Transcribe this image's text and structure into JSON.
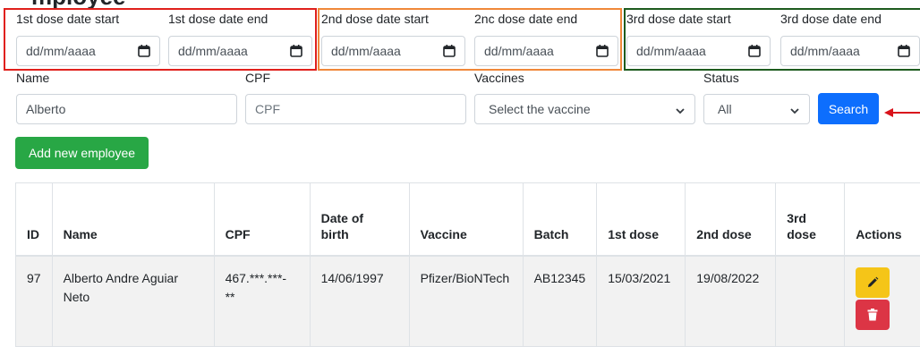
{
  "page": {
    "title_partial": "mployee"
  },
  "filters": {
    "dose1_start_label": "1st dose date start",
    "dose1_end_label": "1st dose date end",
    "dose2_start_label": "2nd dose date start",
    "dose2_end_label": "2nc dose date end",
    "dose3_start_label": "3rd dose date start",
    "dose3_end_label": "3rd dose date end",
    "date_placeholder": "dd/mm/aaaa",
    "name_label": "Name",
    "name_value": "Alberto",
    "cpf_label": "CPF",
    "cpf_placeholder": "CPF",
    "vaccines_label": "Vaccines",
    "vaccines_selected": "Select the vaccine",
    "status_label": "Status",
    "status_selected": "All",
    "search_button": "Search"
  },
  "annotations": {
    "dose1_box_color": "#e0201c",
    "dose2_box_color": "#f0883a",
    "dose3_box_color": "#1d5b1e",
    "arrow_color": "#d9121b"
  },
  "actions": {
    "add_employee_button": "Add new employee"
  },
  "colors": {
    "primary": "#0d6efd",
    "success": "#28a745",
    "warning": "#f5c518",
    "danger": "#dc3545"
  },
  "table": {
    "headers": {
      "id": "ID",
      "name": "Name",
      "cpf": "CPF",
      "dob_line1": "Date of",
      "dob_line2": "birth",
      "vaccine": "Vaccine",
      "batch": "Batch",
      "dose1": "1st dose",
      "dose2": "2nd dose",
      "dose3_line1": "3rd",
      "dose3_line2": "dose",
      "actions": "Actions"
    },
    "rows": [
      {
        "id": "97",
        "name_line1": "Alberto Andre Aguiar",
        "name_line2": "Neto",
        "cpf_line1": "467.***.***-",
        "cpf_line2": "**",
        "dob": "14/06/1997",
        "vaccine": "Pfizer/BioNTech",
        "batch": "AB12345",
        "dose1": "15/03/2021",
        "dose2": "19/08/2022",
        "dose3": "",
        "edit_icon": "pencil-icon",
        "delete_icon": "trash-icon"
      }
    ]
  }
}
